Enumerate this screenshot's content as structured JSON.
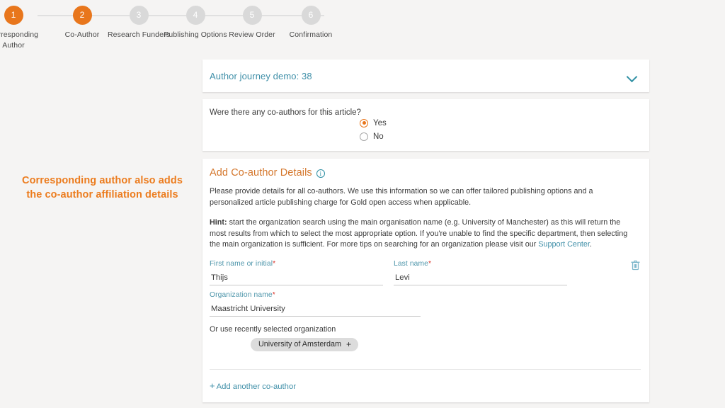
{
  "colors": {
    "brand_orange": "#e8761c",
    "annotation_orange": "#ec7c1e",
    "link_teal": "#3f8fa8",
    "label_teal": "#4d95aa",
    "heading_orange": "#d4762b",
    "required_red": "#d93025",
    "page_background": "#f5f4f3",
    "inactive_step": "#d9d9d9"
  },
  "stepper": {
    "steps": [
      {
        "number": "1",
        "label": "Corresponding Author",
        "state": "active"
      },
      {
        "number": "2",
        "label": "Co-Author",
        "state": "active"
      },
      {
        "number": "3",
        "label": "Research Funders",
        "state": "inactive"
      },
      {
        "number": "4",
        "label": "Publishing Options",
        "state": "inactive"
      },
      {
        "number": "5",
        "label": "Review Order",
        "state": "inactive"
      },
      {
        "number": "6",
        "label": "Confirmation",
        "state": "inactive"
      }
    ]
  },
  "annotation": {
    "text": "Corresponding author also adds the co-author affiliation details"
  },
  "journey_card": {
    "title": "Author journey demo: 38",
    "chevron_icon": "chevron-down-icon"
  },
  "question_card": {
    "question": "Were there any co-authors for this article?",
    "options": [
      {
        "label": "Yes",
        "selected": true
      },
      {
        "label": "No",
        "selected": false
      }
    ]
  },
  "details_card": {
    "title": "Add Co-author Details",
    "info_icon": "info-icon",
    "info_glyph": "i",
    "paragraph_1": "Please provide details for all co-authors. We use this information so we can offer tailored publishing options and a personalized article publishing charge for Gold open access when applicable.",
    "hint_label": "Hint:",
    "hint_body": " start the organization search using the main organisation name (e.g. University of Manchester) as this will return the most results from which to select the most appropriate option. If you're unable to find the specific department, then selecting the main organization is sufficient. For more tips on searching for an organization please visit our ",
    "hint_link": "Support Center",
    "hint_end": ".",
    "fields": {
      "first_name": {
        "label": "First name or initial",
        "required_marker": "*",
        "value": "Thijs",
        "placeholder": ""
      },
      "last_name": {
        "label": "Last name",
        "required_marker": "*",
        "value": "Levi",
        "placeholder": ""
      },
      "organization": {
        "label": "Organization name",
        "required_marker": "*",
        "value": "Maastricht University",
        "placeholder": ""
      }
    },
    "delete_icon": "trash-icon",
    "recent_org_label": "Or use recently selected organization",
    "recent_org_chip": "University of Amsterdam",
    "recent_org_chip_plus": "+",
    "add_another_plus": "+",
    "add_another_label": "Add another co-author"
  }
}
